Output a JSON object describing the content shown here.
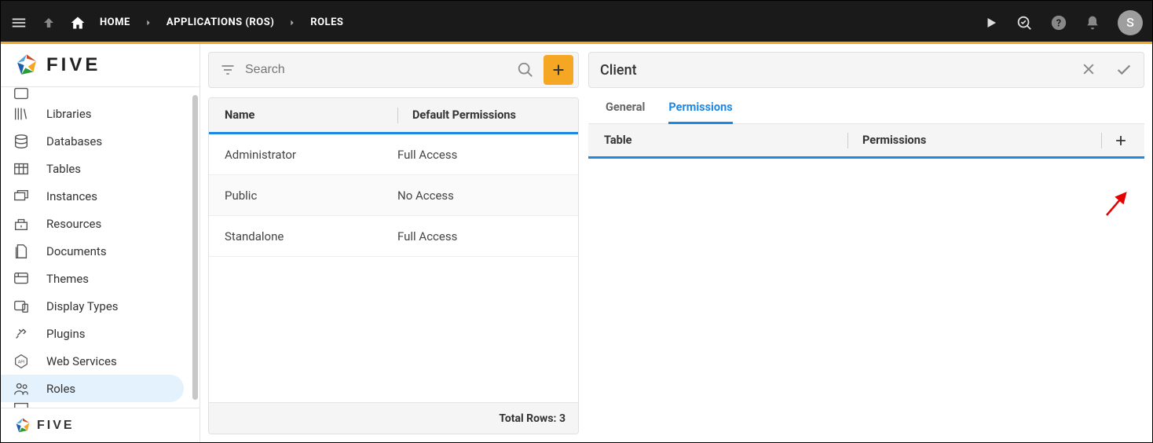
{
  "topbar": {
    "breadcrumb": [
      "HOME",
      "APPLICATIONS (ROS)",
      "ROLES"
    ],
    "avatar_letter": "S"
  },
  "brand": {
    "name": "FIVE"
  },
  "sidebar": {
    "items": [
      {
        "label": "Libraries"
      },
      {
        "label": "Databases"
      },
      {
        "label": "Tables"
      },
      {
        "label": "Instances"
      },
      {
        "label": "Resources"
      },
      {
        "label": "Documents"
      },
      {
        "label": "Themes"
      },
      {
        "label": "Display Types"
      },
      {
        "label": "Plugins"
      },
      {
        "label": "Web Services"
      },
      {
        "label": "Roles",
        "active": true
      }
    ]
  },
  "list": {
    "search_placeholder": "Search",
    "columns": [
      "Name",
      "Default Permissions"
    ],
    "rows": [
      {
        "name": "Administrator",
        "perm": "Full Access"
      },
      {
        "name": "Public",
        "perm": "No Access"
      },
      {
        "name": "Standalone",
        "perm": "Full Access"
      }
    ],
    "footer_label": "Total Rows:",
    "footer_count": "3"
  },
  "detail": {
    "title": "Client",
    "tabs": [
      "General",
      "Permissions"
    ],
    "active_tab": 1,
    "perm_columns": [
      "Table",
      "Permissions"
    ]
  }
}
